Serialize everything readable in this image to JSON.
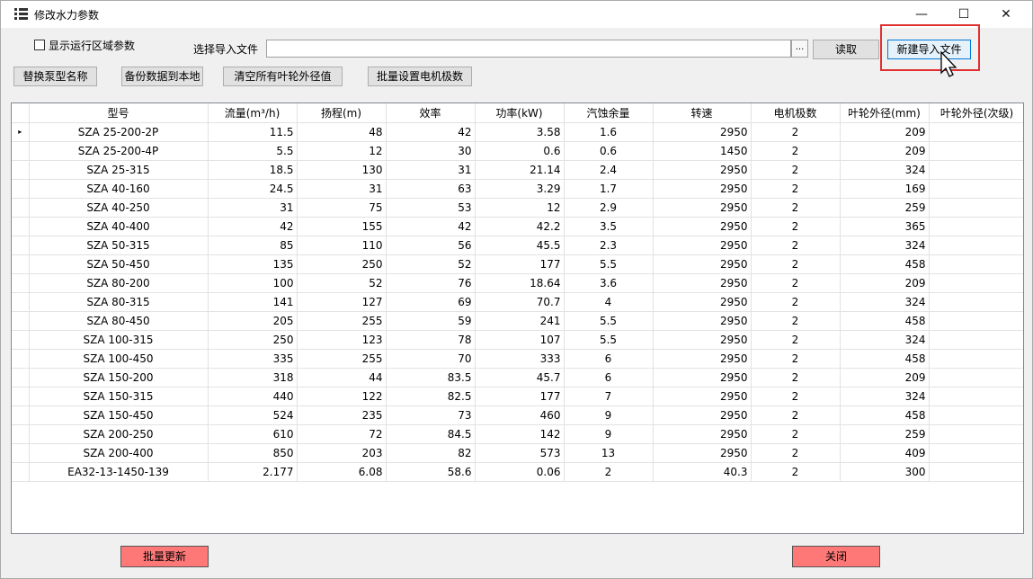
{
  "window": {
    "title": "修改水力参数",
    "minimize_glyph": "—",
    "maximize_glyph": "☐",
    "close_glyph": "✕"
  },
  "top": {
    "show_region_label": "显示运行区域参数",
    "show_region_checked": false,
    "file_label": "选择导入文件",
    "file_value": "",
    "browse_label": "...",
    "read_label": "读取",
    "new_import_label": "新建导入文件"
  },
  "actions": {
    "replace_pump_name": "替换泵型名称",
    "backup_local": "备份数据到本地",
    "clear_impeller": "清空所有叶轮外径值",
    "batch_motor_poles": "批量设置电机极数"
  },
  "table": {
    "headers": [
      "型号",
      "流量(m³/h)",
      "扬程(m)",
      "效率",
      "功率(kW)",
      "汽蚀余量",
      "转速",
      "电机极数",
      "叶轮外径(mm)",
      "叶轮外径(次级)"
    ],
    "rows": [
      [
        "SZA 25-200-2P",
        "11.5",
        "48",
        "42",
        "3.58",
        "1.6",
        "2950",
        "2",
        "209",
        ""
      ],
      [
        "SZA 25-200-4P",
        "5.5",
        "12",
        "30",
        "0.6",
        "0.6",
        "1450",
        "2",
        "209",
        ""
      ],
      [
        "SZA 25-315",
        "18.5",
        "130",
        "31",
        "21.14",
        "2.4",
        "2950",
        "2",
        "324",
        ""
      ],
      [
        "SZA 40-160",
        "24.5",
        "31",
        "63",
        "3.29",
        "1.7",
        "2950",
        "2",
        "169",
        ""
      ],
      [
        "SZA 40-250",
        "31",
        "75",
        "53",
        "12",
        "2.9",
        "2950",
        "2",
        "259",
        ""
      ],
      [
        "SZA 40-400",
        "42",
        "155",
        "42",
        "42.2",
        "3.5",
        "2950",
        "2",
        "365",
        ""
      ],
      [
        "SZA 50-315",
        "85",
        "110",
        "56",
        "45.5",
        "2.3",
        "2950",
        "2",
        "324",
        ""
      ],
      [
        "SZA 50-450",
        "135",
        "250",
        "52",
        "177",
        "5.5",
        "2950",
        "2",
        "458",
        ""
      ],
      [
        "SZA 80-200",
        "100",
        "52",
        "76",
        "18.64",
        "3.6",
        "2950",
        "2",
        "209",
        ""
      ],
      [
        "SZA 80-315",
        "141",
        "127",
        "69",
        "70.7",
        "4",
        "2950",
        "2",
        "324",
        ""
      ],
      [
        "SZA 80-450",
        "205",
        "255",
        "59",
        "241",
        "5.5",
        "2950",
        "2",
        "458",
        ""
      ],
      [
        "SZA 100-315",
        "250",
        "123",
        "78",
        "107",
        "5.5",
        "2950",
        "2",
        "324",
        ""
      ],
      [
        "SZA 100-450",
        "335",
        "255",
        "70",
        "333",
        "6",
        "2950",
        "2",
        "458",
        ""
      ],
      [
        "SZA 150-200",
        "318",
        "44",
        "83.5",
        "45.7",
        "6",
        "2950",
        "2",
        "209",
        ""
      ],
      [
        "SZA 150-315",
        "440",
        "122",
        "82.5",
        "177",
        "7",
        "2950",
        "2",
        "324",
        ""
      ],
      [
        "SZA 150-450",
        "524",
        "235",
        "73",
        "460",
        "9",
        "2950",
        "2",
        "458",
        ""
      ],
      [
        "SZA 200-250",
        "610",
        "72",
        "84.5",
        "142",
        "9",
        "2950",
        "2",
        "259",
        ""
      ],
      [
        "SZA 200-400",
        "850",
        "203",
        "82",
        "573",
        "13",
        "2950",
        "2",
        "409",
        ""
      ],
      [
        "EA32-13-1450-139",
        "2.177",
        "6.08",
        "58.6",
        "0.06",
        "2",
        "40.3",
        "2",
        "300",
        ""
      ]
    ],
    "current_row_marker": "▸"
  },
  "bottom": {
    "batch_update": "批量更新",
    "close": "关闭"
  },
  "colors": {
    "highlight_box": "#e03030",
    "action_red": "#ff7878",
    "focused_button": "#e5f1fb"
  }
}
